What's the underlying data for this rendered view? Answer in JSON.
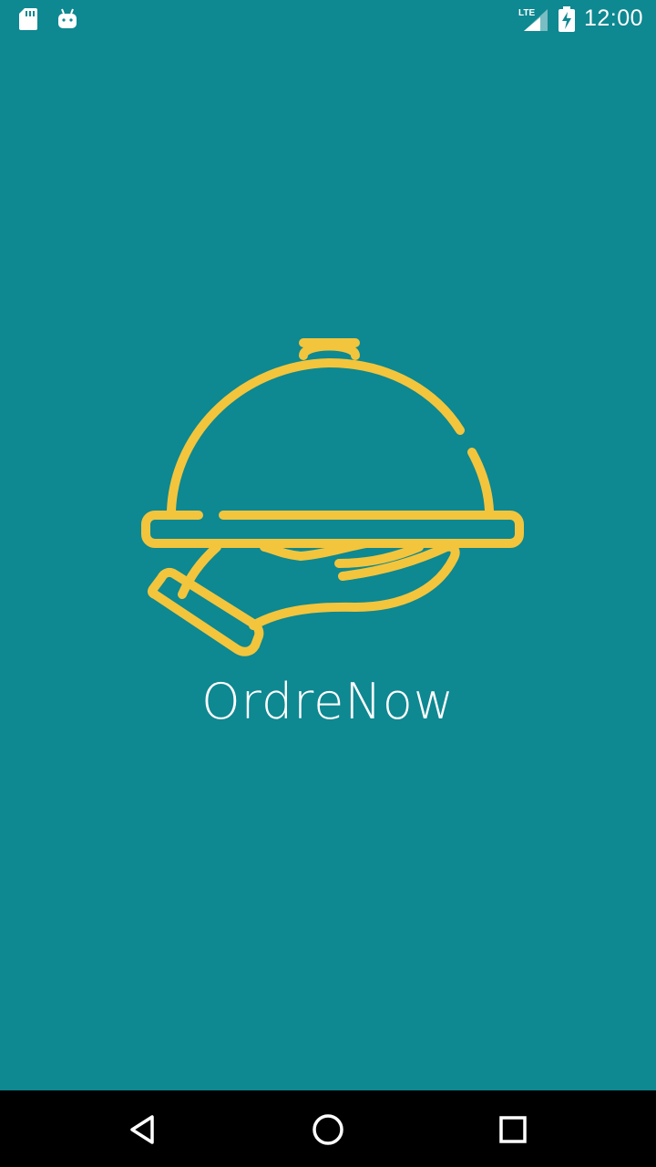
{
  "status_bar": {
    "time": "12:00",
    "network_label": "LTE",
    "icons": [
      "sd-card-icon",
      "android-debug-icon",
      "lte-signal-icon",
      "battery-charging-icon"
    ]
  },
  "splash": {
    "app_name": "OrdreNow",
    "logo_icon": "cloche-serving-hand-icon"
  },
  "navigation": {
    "buttons": [
      "back-icon",
      "home-icon",
      "recents-icon"
    ]
  },
  "colors": {
    "background": "#0e8891",
    "logo": "#f2c53d",
    "text": "#ffffff",
    "nav_bar": "#000000"
  }
}
